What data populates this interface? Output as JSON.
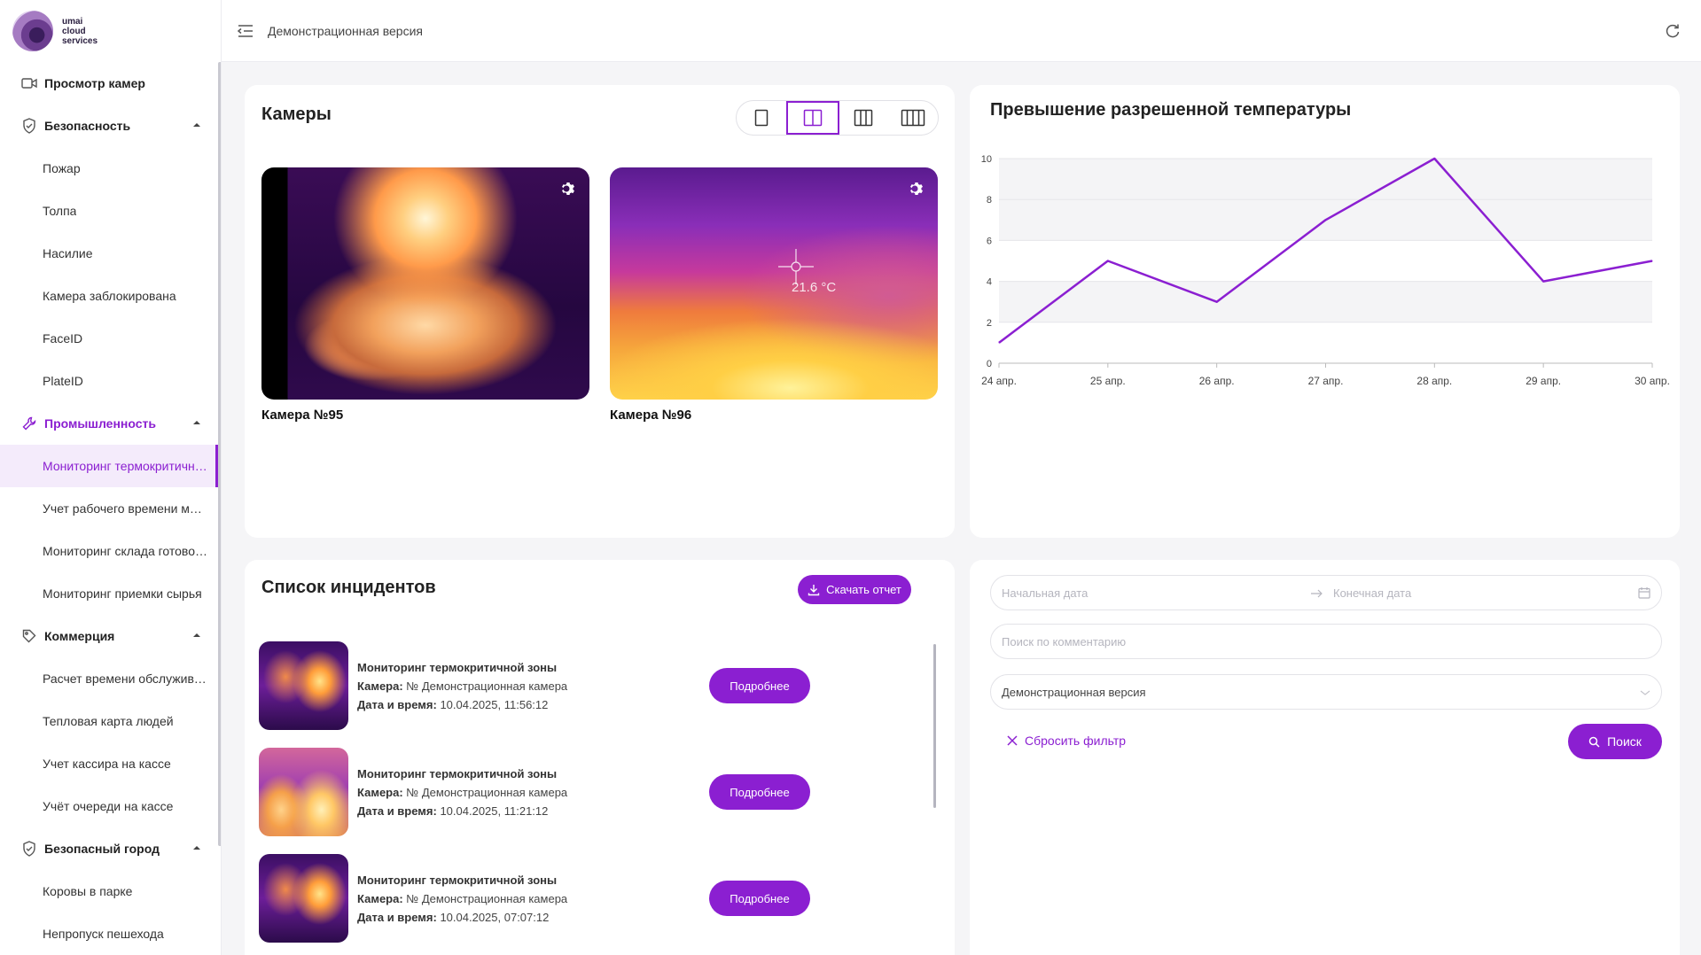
{
  "brand": {
    "line1": "umai",
    "line2": "cloud",
    "line3": "services"
  },
  "header": {
    "title": "Демонстрационная версия"
  },
  "sidebar": {
    "items": [
      {
        "label": "Просмотр камер",
        "type": "group",
        "icon": "video-camera-icon"
      },
      {
        "label": "Безопасность",
        "type": "group",
        "icon": "shield-icon"
      },
      {
        "label": "Пожар",
        "type": "sub"
      },
      {
        "label": "Толпа",
        "type": "sub"
      },
      {
        "label": "Насилие",
        "type": "sub"
      },
      {
        "label": "Камера заблокирована",
        "type": "sub"
      },
      {
        "label": "FaceID",
        "type": "sub"
      },
      {
        "label": "PlateID",
        "type": "sub"
      },
      {
        "label": "Промышленность",
        "type": "group",
        "icon": "wrench-icon"
      },
      {
        "label": "Мониторинг термокритичной зоны",
        "type": "sub"
      },
      {
        "label": "Учет рабочего времени машин",
        "type": "sub"
      },
      {
        "label": "Мониторинг склада готовой продукции",
        "type": "sub"
      },
      {
        "label": "Мониторинг приемки сырья",
        "type": "sub"
      },
      {
        "label": "Коммерция",
        "type": "group",
        "icon": "tag-icon"
      },
      {
        "label": "Расчет времени обслуживания",
        "type": "sub"
      },
      {
        "label": "Тепловая карта людей",
        "type": "sub"
      },
      {
        "label": "Учет кассира на кассе",
        "type": "sub"
      },
      {
        "label": "Учёт очереди на кассе",
        "type": "sub"
      },
      {
        "label": "Безопасный город",
        "type": "group",
        "icon": "shield-check-icon"
      },
      {
        "label": "Коровы в парке",
        "type": "sub"
      },
      {
        "label": "Непропуск пешехода",
        "type": "sub"
      }
    ]
  },
  "cameras": {
    "title": "Камеры",
    "tiles": [
      {
        "label": "Камера №95"
      },
      {
        "label": "Камера №96",
        "reading": "21.6 °C"
      }
    ]
  },
  "chart_data": {
    "type": "line",
    "title": "Превышение разрешенной температуры",
    "categories": [
      "24 апр.",
      "25 апр.",
      "26 апр.",
      "27 апр.",
      "28 апр.",
      "29 апр.",
      "30 апр."
    ],
    "series": [
      {
        "values": [
          1,
          5,
          3,
          7,
          10,
          4,
          5
        ],
        "color": "#8b1fd1"
      }
    ],
    "yticks": [
      0,
      2,
      4,
      6,
      8,
      10
    ],
    "ylim": [
      0,
      10
    ],
    "grid": true,
    "banding": true
  },
  "incidents": {
    "title": "Список инцидентов",
    "download_label": "Скачать отчет",
    "items": [
      {
        "title": "Мониторинг термокритичной зоны",
        "camera_label": "Камера:",
        "camera": "№ Демонстрационная камера",
        "date_label": "Дата и время:",
        "date": "10.04.2025, 11:56:12",
        "button": "Подробнее"
      },
      {
        "title": "Мониторинг термокритичной зоны",
        "camera_label": "Камера:",
        "camera": "№ Демонстрационная камера",
        "date_label": "Дата и время:",
        "date": "10.04.2025, 11:21:12",
        "button": "Подробнее"
      },
      {
        "title": "Мониторинг термокритичной зоны",
        "camera_label": "Камера:",
        "camera": "№ Демонстрационная камера",
        "date_label": "Дата и время:",
        "date": "10.04.2025, 07:07:12",
        "button": "Подробнее"
      }
    ]
  },
  "filters": {
    "start_date_placeholder": "Начальная дата",
    "end_date_placeholder": "Конечная дата",
    "comment_placeholder": "Поиск по комментарию",
    "select_value": "Демонстрационная версия",
    "reset_label": "Сбросить фильтр",
    "search_label": "Поиск"
  },
  "colors": {
    "accent": "#8b1fd1",
    "selected_bg": "#f4ebfb"
  }
}
